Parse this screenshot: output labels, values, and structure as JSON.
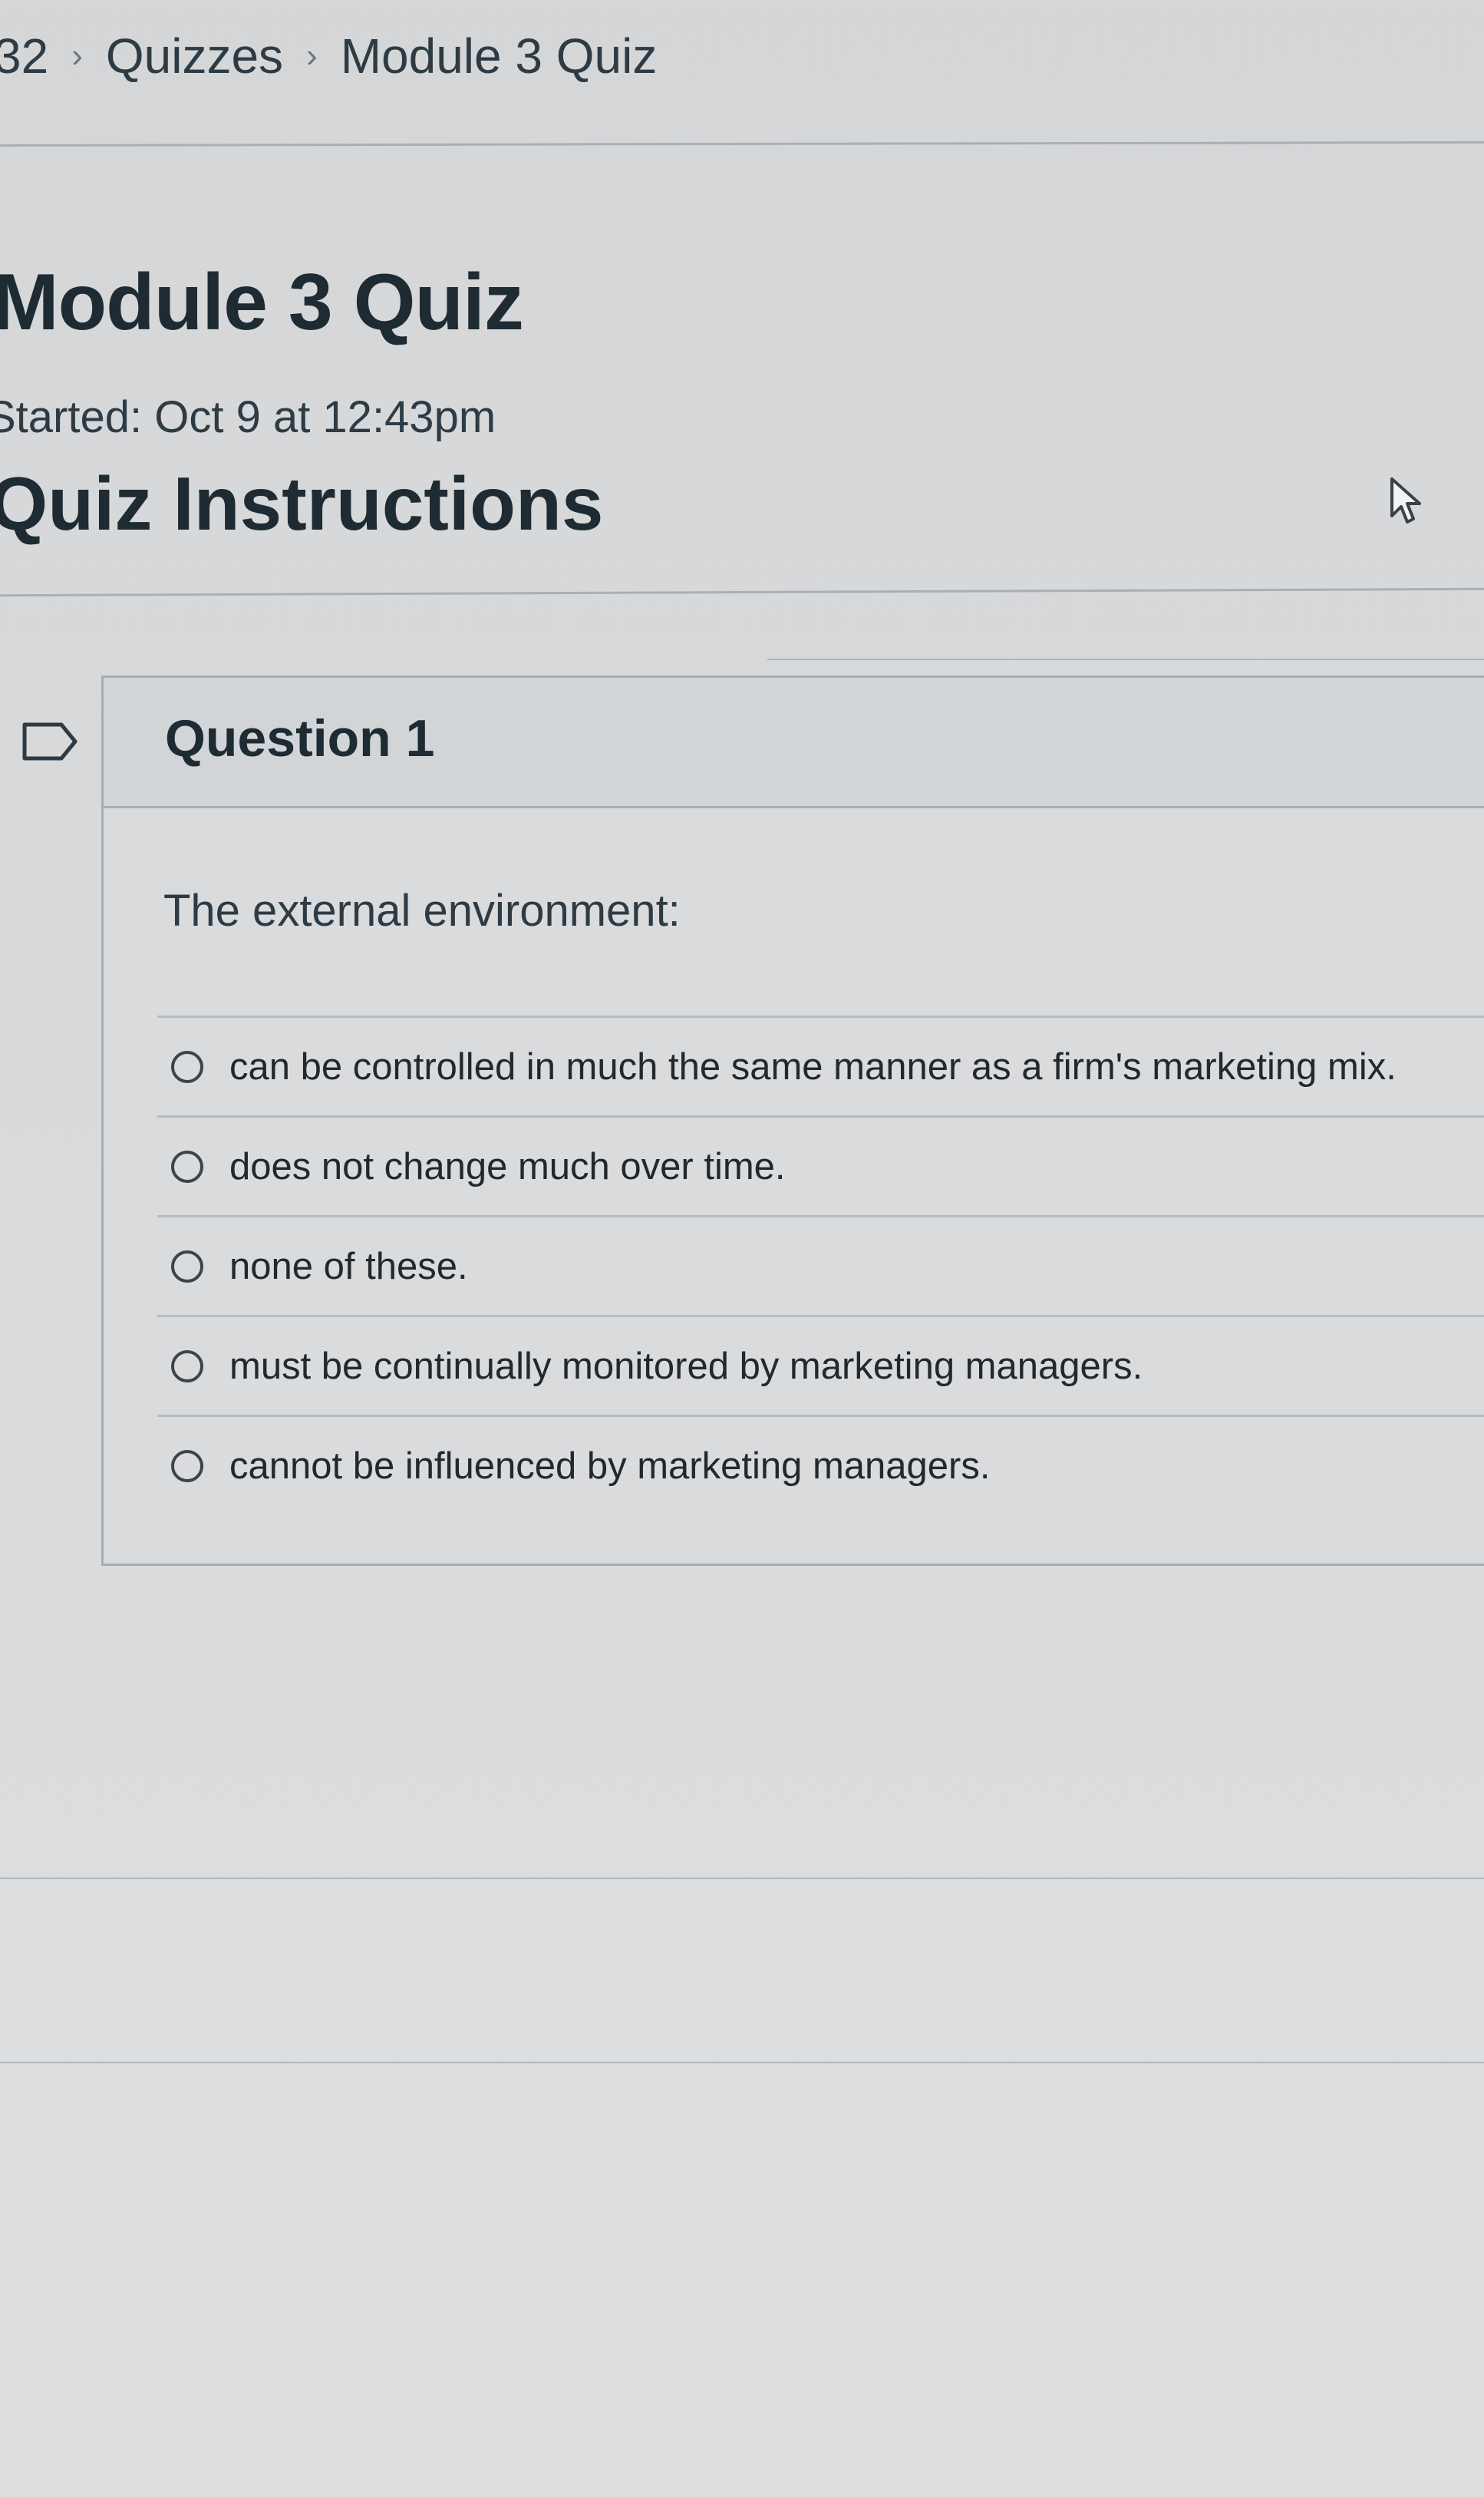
{
  "breadcrumb": {
    "items": [
      "32",
      "Quizzes",
      "Module 3 Quiz"
    ],
    "separator": "›"
  },
  "quiz": {
    "title": "Module 3 Quiz",
    "started": "Started: Oct 9 at 12:43pm",
    "instructions_heading": "Quiz Instructions"
  },
  "question": {
    "number_label": "Question 1",
    "text": "The external environment:",
    "answers": [
      "can be controlled in much the same manner as a firm's marketing mix.",
      "does not change much over time.",
      "none of these.",
      "must be continually monitored by marketing managers.",
      "cannot be influenced by marketing managers."
    ]
  },
  "icons": {
    "flag": "flag-icon",
    "cursor": "mouse-pointer-icon",
    "radio": "radio-unselected-icon"
  },
  "colors": {
    "text": "#2d3b45",
    "heading": "#1f2b33",
    "border": "#a7adb2",
    "background": "#d7d9db"
  }
}
